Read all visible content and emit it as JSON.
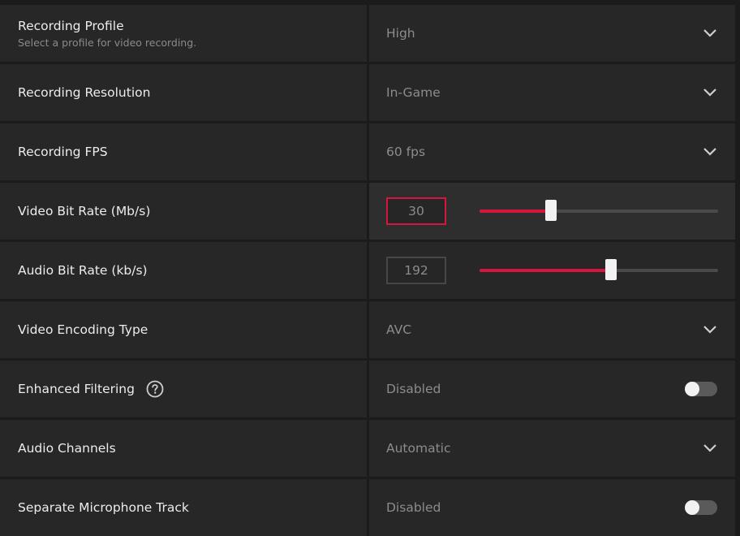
{
  "rows": [
    {
      "label": "Recording Profile",
      "sublabel": "Select a profile for video recording.",
      "value": "High"
    },
    {
      "label": "Recording Resolution",
      "value": "In-Game"
    },
    {
      "label": "Recording FPS",
      "value": "60 fps"
    },
    {
      "label": "Video Bit Rate (Mb/s)",
      "value": "30",
      "slider_fraction": 0.3
    },
    {
      "label": "Audio Bit Rate (kb/s)",
      "value": "192",
      "slider_fraction": 0.55
    },
    {
      "label": "Video Encoding Type",
      "value": "AVC"
    },
    {
      "label": "Enhanced Filtering",
      "value": "Disabled",
      "toggle_on": false
    },
    {
      "label": "Audio Channels",
      "value": "Automatic"
    },
    {
      "label": "Separate Microphone Track",
      "value": "Disabled",
      "toggle_on": false
    }
  ],
  "colors": {
    "accent": "#d6163c",
    "row_bg": "#272727",
    "background": "#1b1b1b",
    "label_text": "#ececec",
    "value_text": "#8c8c8c"
  },
  "icons": {
    "dropdown": "chevron-down-icon",
    "help": "help-circle-icon"
  }
}
